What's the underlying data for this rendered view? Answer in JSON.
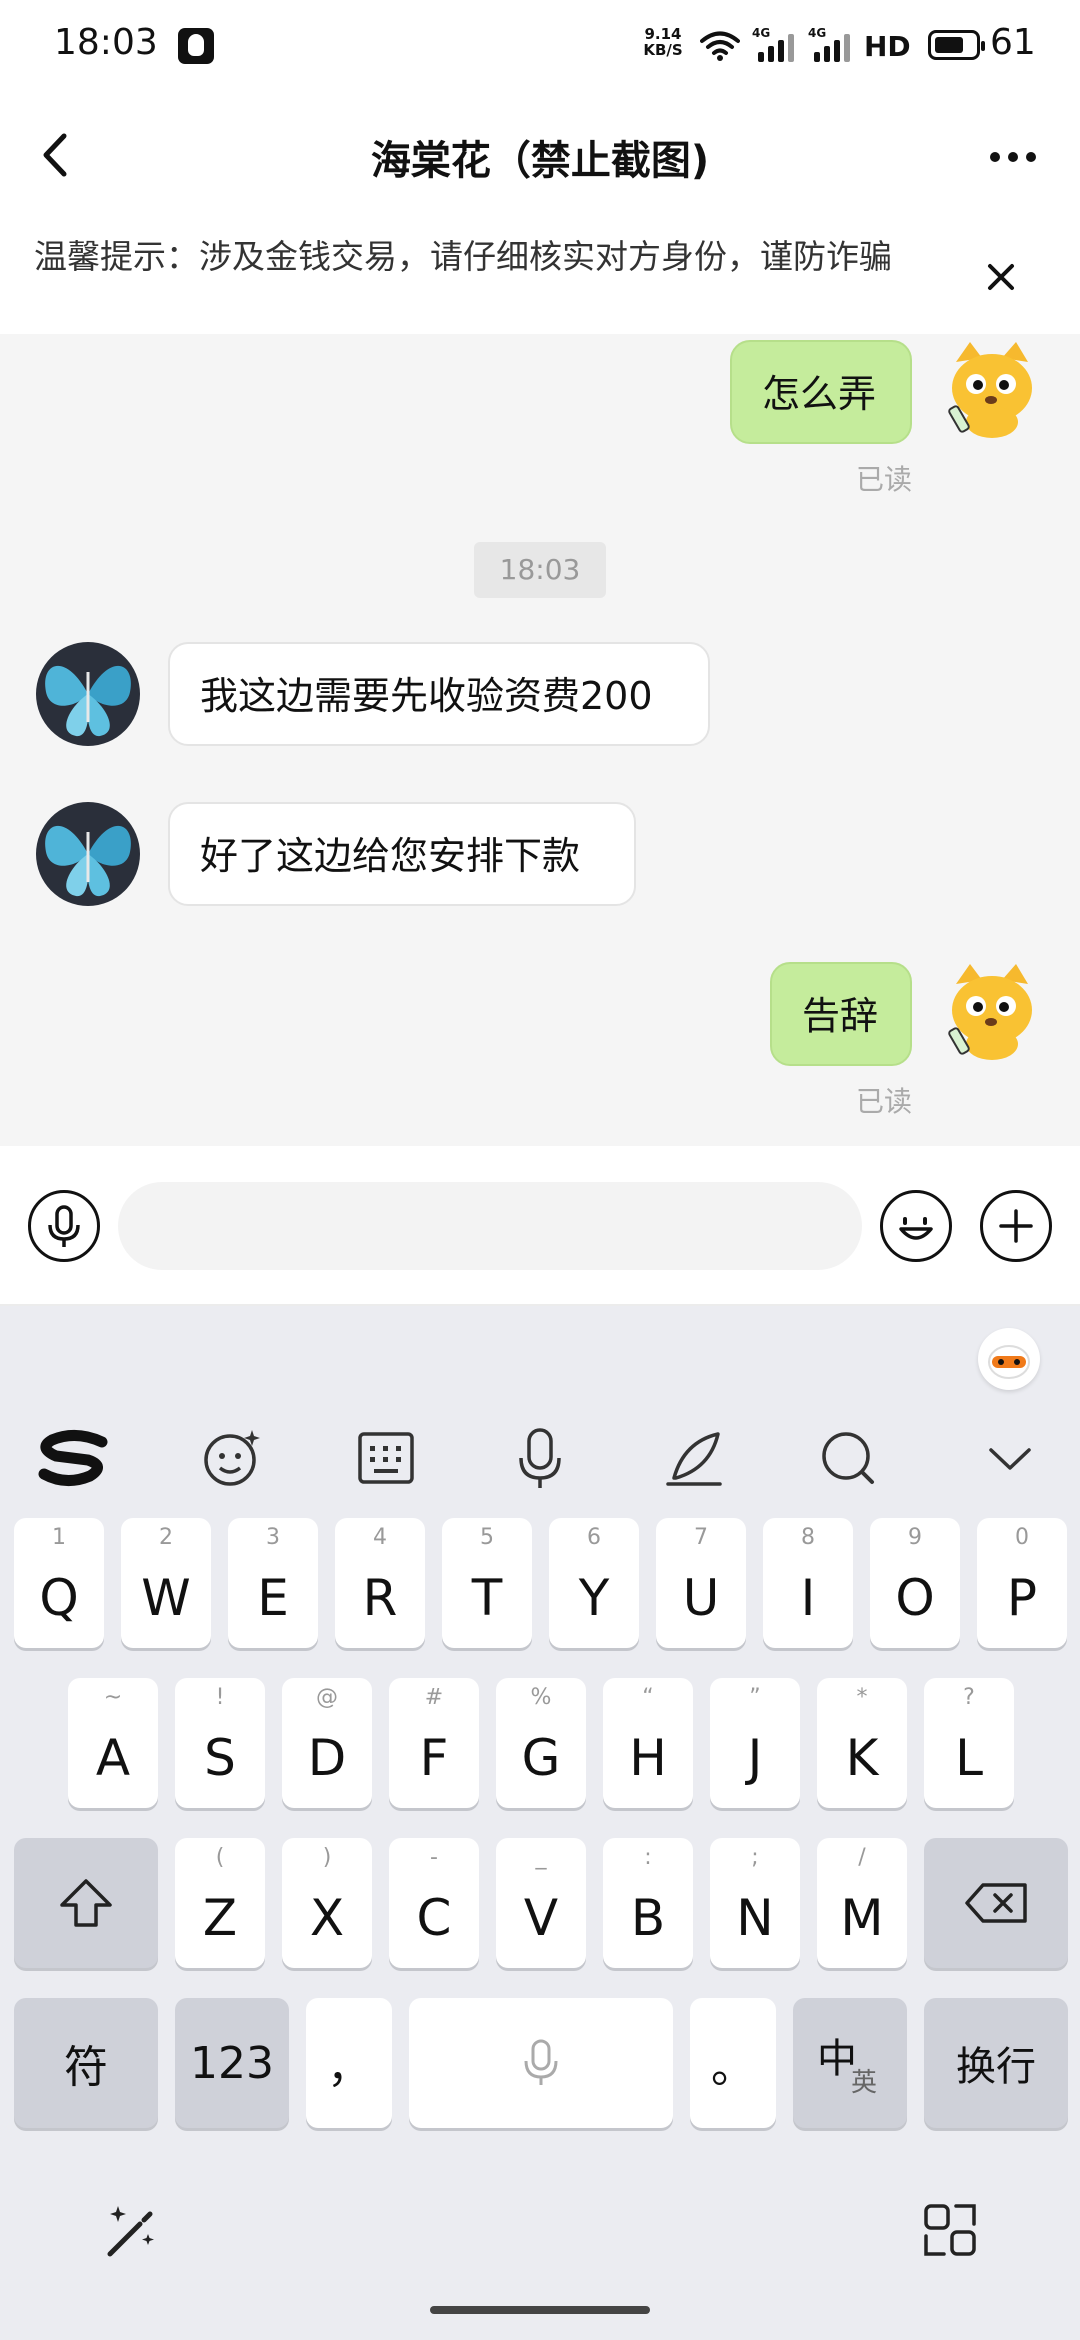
{
  "status_bar": {
    "time": "18:03",
    "net_speed_value": "9.14",
    "net_speed_unit": "KB/S",
    "sim1": "4G",
    "sim2": "4G",
    "hd": "HD",
    "battery": "61"
  },
  "header": {
    "title": "海棠花（禁止截图)",
    "back_icon": "chevron-left-icon",
    "more_icon": "more-horizontal-icon"
  },
  "notice": {
    "text": "温馨提示：涉及金钱交易，请仔细核实对方身份，谨防诈骗"
  },
  "chat": {
    "messages": [
      {
        "direction": "out",
        "text": "怎么弄",
        "status": "已读"
      },
      {
        "direction": "in",
        "text": "我这边需要先收验资费200"
      },
      {
        "direction": "in",
        "text": "好了这边给您安排下款"
      },
      {
        "direction": "out",
        "text": "告辞",
        "status": "已读"
      }
    ],
    "time_divider": "18:03"
  },
  "input_bar": {
    "placeholder": "",
    "voice_icon": "microphone-icon",
    "emoji_icon": "emoji-icon",
    "plus_icon": "plus-icon"
  },
  "keyboard": {
    "row1": [
      {
        "main": "Q",
        "sub": "1"
      },
      {
        "main": "W",
        "sub": "2"
      },
      {
        "main": "E",
        "sub": "3"
      },
      {
        "main": "R",
        "sub": "4"
      },
      {
        "main": "T",
        "sub": "5"
      },
      {
        "main": "Y",
        "sub": "6"
      },
      {
        "main": "U",
        "sub": "7"
      },
      {
        "main": "I",
        "sub": "8"
      },
      {
        "main": "O",
        "sub": "9"
      },
      {
        "main": "P",
        "sub": "0"
      }
    ],
    "row2": [
      {
        "main": "A",
        "sub": "~"
      },
      {
        "main": "S",
        "sub": "!"
      },
      {
        "main": "D",
        "sub": "@"
      },
      {
        "main": "F",
        "sub": "#"
      },
      {
        "main": "G",
        "sub": "%"
      },
      {
        "main": "H",
        "sub": "“"
      },
      {
        "main": "J",
        "sub": "”"
      },
      {
        "main": "K",
        "sub": "*"
      },
      {
        "main": "L",
        "sub": "?"
      }
    ],
    "row3": [
      {
        "main": "Z",
        "sub": "("
      },
      {
        "main": "X",
        "sub": ")"
      },
      {
        "main": "C",
        "sub": "-"
      },
      {
        "main": "V",
        "sub": "_"
      },
      {
        "main": "B",
        "sub": ":"
      },
      {
        "main": "N",
        "sub": ";"
      },
      {
        "main": "M",
        "sub": "/"
      }
    ],
    "symbol_key": "符",
    "num_key": "123",
    "comma_key": "，",
    "period_key": "。",
    "lang_key_main": "中",
    "lang_key_sub": "英",
    "enter_key": "换行"
  }
}
